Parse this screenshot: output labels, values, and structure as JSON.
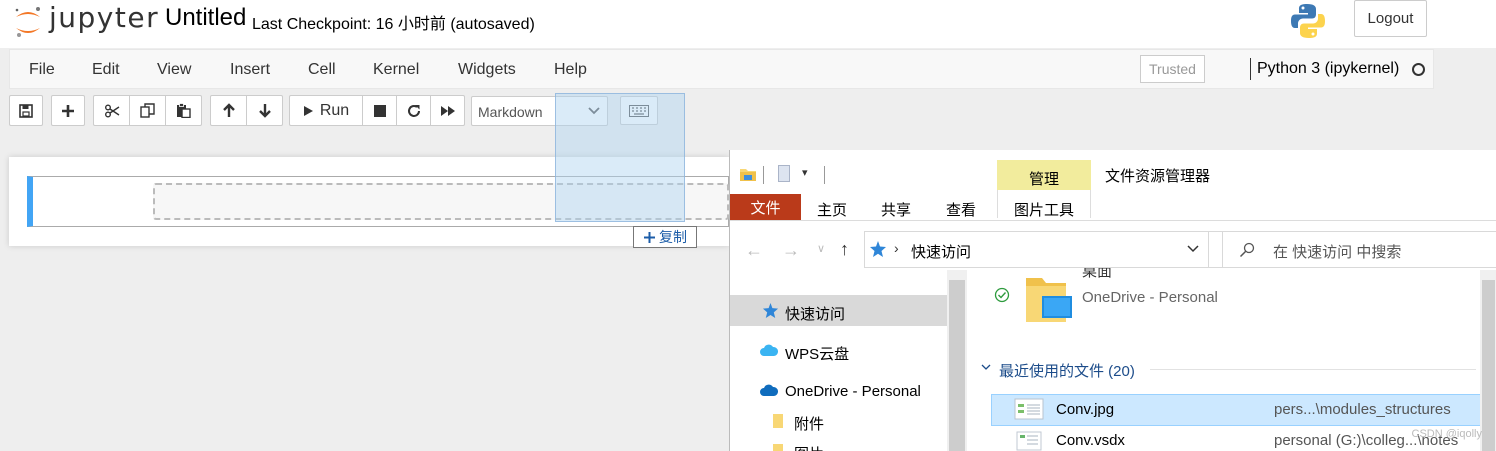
{
  "header": {
    "logo_text": "jupyter",
    "title": "Untitled",
    "checkpoint": "Last Checkpoint: 16 小时前   (autosaved)",
    "logout_label": "Logout"
  },
  "menubar": {
    "items": [
      "File",
      "Edit",
      "View",
      "Insert",
      "Cell",
      "Kernel",
      "Widgets",
      "Help"
    ],
    "trusted_label": "Trusted",
    "kernel_name": "Python 3 (ipykernel)"
  },
  "toolbar": {
    "run_label": "Run",
    "cell_type": "Markdown"
  },
  "drag_tooltip": {
    "label": "复制"
  },
  "explorer": {
    "title": "文件资源管理器",
    "manage_tab": "管理",
    "tabs": [
      "文件",
      "主页",
      "共享",
      "查看",
      "图片工具"
    ],
    "address": "快速访问",
    "search_placeholder": "在 快速访问 中搜索",
    "nav_items": [
      {
        "label": "快速访问",
        "icon": "star-icon"
      },
      {
        "label": "WPS云盘",
        "icon": "cloud-icon"
      },
      {
        "label": "OneDrive - Personal",
        "icon": "cloud-icon"
      },
      {
        "label": "附件",
        "icon": "folder-icon"
      },
      {
        "label": "图片",
        "icon": "folder-icon"
      }
    ],
    "pinned_item": {
      "name": "桌面",
      "location": "OneDrive - Personal"
    },
    "recent_header": "最近使用的文件 (20)",
    "recent_files": [
      {
        "name": "Conv.jpg",
        "path": "pers...\\modules_structures"
      },
      {
        "name": "Conv.vsdx",
        "path": "personal (G:)\\colleg...\\notes"
      }
    ]
  },
  "watermark": "CSDN @iqolly",
  "colors": {
    "jupyter_orange": "#f37726",
    "cell_selected": "#42a5f5",
    "file_tab": "#ba3a1a",
    "manage_tab": "#f2ec9d",
    "selection": "#cce8ff"
  }
}
